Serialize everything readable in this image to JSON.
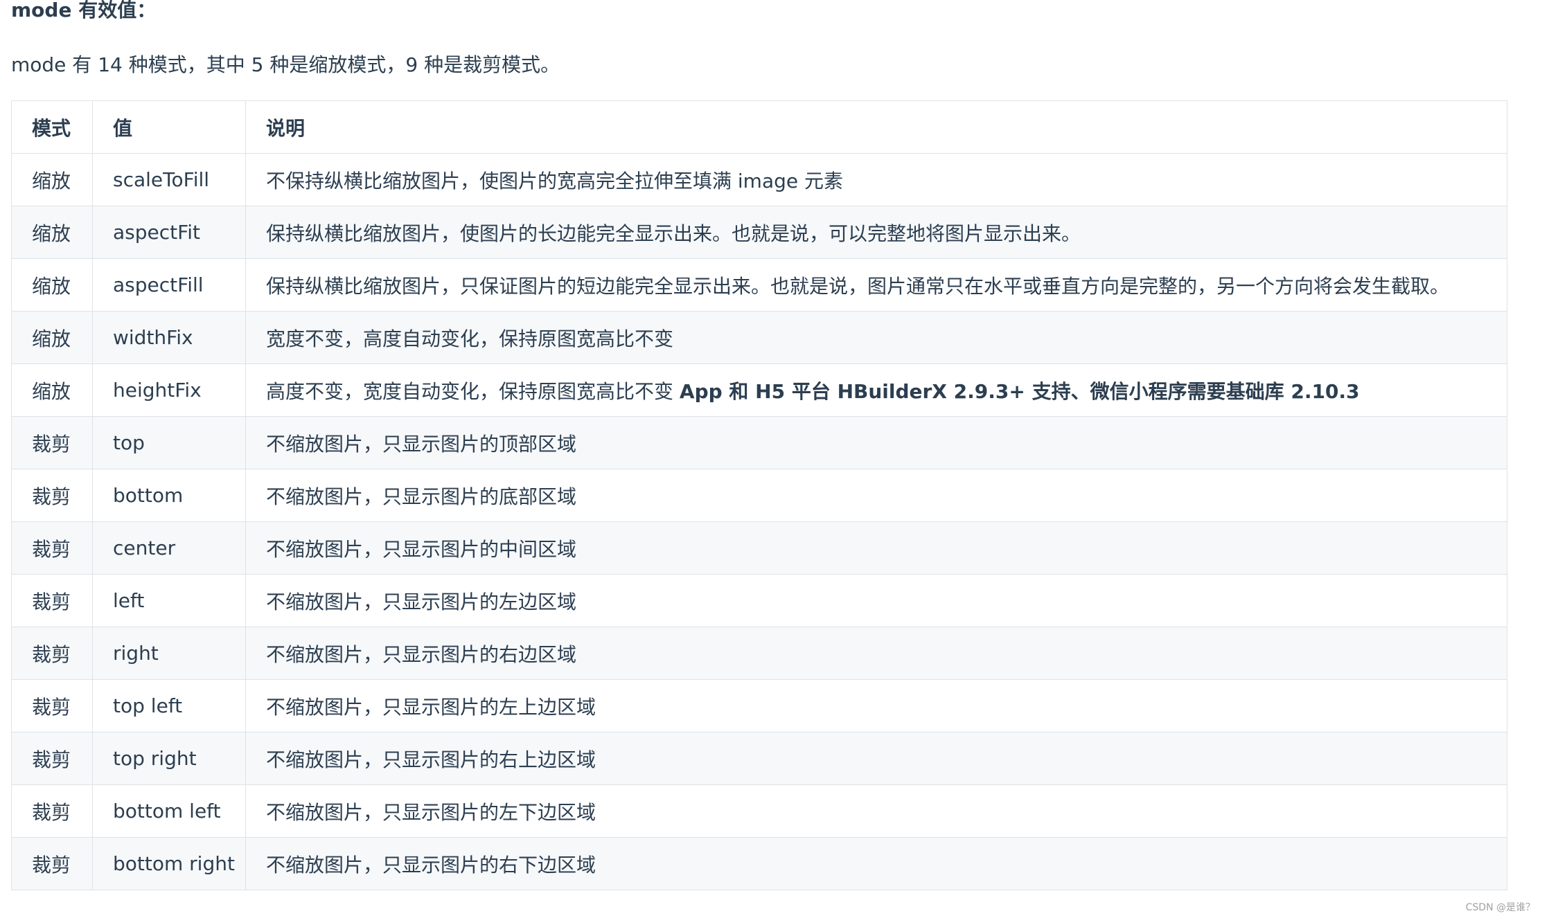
{
  "heading": "mode 有效值：",
  "intro": "mode 有 14 种模式，其中 5 种是缩放模式，9 种是裁剪模式。",
  "table": {
    "headers": [
      "模式",
      "值",
      "说明"
    ],
    "rows": [
      {
        "mode": "缩放",
        "value": "scaleToFill",
        "desc": "不保持纵横比缩放图片，使图片的宽高完全拉伸至填满 image 元素",
        "desc_bold": ""
      },
      {
        "mode": "缩放",
        "value": "aspectFit",
        "desc": "保持纵横比缩放图片，使图片的长边能完全显示出来。也就是说，可以完整地将图片显示出来。",
        "desc_bold": ""
      },
      {
        "mode": "缩放",
        "value": "aspectFill",
        "desc": "保持纵横比缩放图片，只保证图片的短边能完全显示出来。也就是说，图片通常只在水平或垂直方向是完整的，另一个方向将会发生截取。",
        "desc_bold": ""
      },
      {
        "mode": "缩放",
        "value": "widthFix",
        "desc": "宽度不变，高度自动变化，保持原图宽高比不变",
        "desc_bold": ""
      },
      {
        "mode": "缩放",
        "value": "heightFix",
        "desc": "高度不变，宽度自动变化，保持原图宽高比不变 ",
        "desc_bold": "App 和 H5 平台 HBuilderX 2.9.3+ 支持、微信小程序需要基础库 2.10.3"
      },
      {
        "mode": "裁剪",
        "value": "top",
        "desc": "不缩放图片，只显示图片的顶部区域",
        "desc_bold": ""
      },
      {
        "mode": "裁剪",
        "value": "bottom",
        "desc": "不缩放图片，只显示图片的底部区域",
        "desc_bold": ""
      },
      {
        "mode": "裁剪",
        "value": "center",
        "desc": "不缩放图片，只显示图片的中间区域",
        "desc_bold": ""
      },
      {
        "mode": "裁剪",
        "value": "left",
        "desc": "不缩放图片，只显示图片的左边区域",
        "desc_bold": ""
      },
      {
        "mode": "裁剪",
        "value": "right",
        "desc": "不缩放图片，只显示图片的右边区域",
        "desc_bold": ""
      },
      {
        "mode": "裁剪",
        "value": "top left",
        "desc": "不缩放图片，只显示图片的左上边区域",
        "desc_bold": ""
      },
      {
        "mode": "裁剪",
        "value": "top right",
        "desc": "不缩放图片，只显示图片的右上边区域",
        "desc_bold": ""
      },
      {
        "mode": "裁剪",
        "value": "bottom left",
        "desc": "不缩放图片，只显示图片的左下边区域",
        "desc_bold": ""
      },
      {
        "mode": "裁剪",
        "value": "bottom right",
        "desc": "不缩放图片，只显示图片的右下边区域",
        "desc_bold": ""
      }
    ]
  },
  "watermark": "CSDN @是谁？"
}
